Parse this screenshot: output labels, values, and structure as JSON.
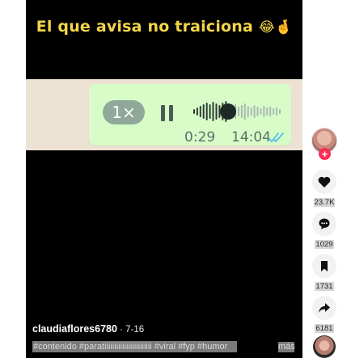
{
  "video": {
    "caption_title": "El que avisa no traiciona",
    "caption_emojis": "😂🤞",
    "voice_note": {
      "speed": "1×",
      "duration": "0:29",
      "timestamp": "14:04",
      "progress": 0.4
    },
    "author": "claudiaflores6780",
    "date_sep": " · ",
    "date": "7-16",
    "hashtags": "#contenido #paratiiiiiiiiiiiiiiiiiiiiiiii #viral #fyp #humor",
    "more_label": "más"
  },
  "rail": {
    "like_count": "23.7K",
    "comment_count": "1029",
    "bookmark_count": "1731",
    "share_count": "6181"
  },
  "colors": {
    "caption_yellow": "#f3d64a",
    "bubble_green": "#d8fcc8",
    "read_ticks": "#53bdeb",
    "follow_red": "#fe2c55"
  }
}
